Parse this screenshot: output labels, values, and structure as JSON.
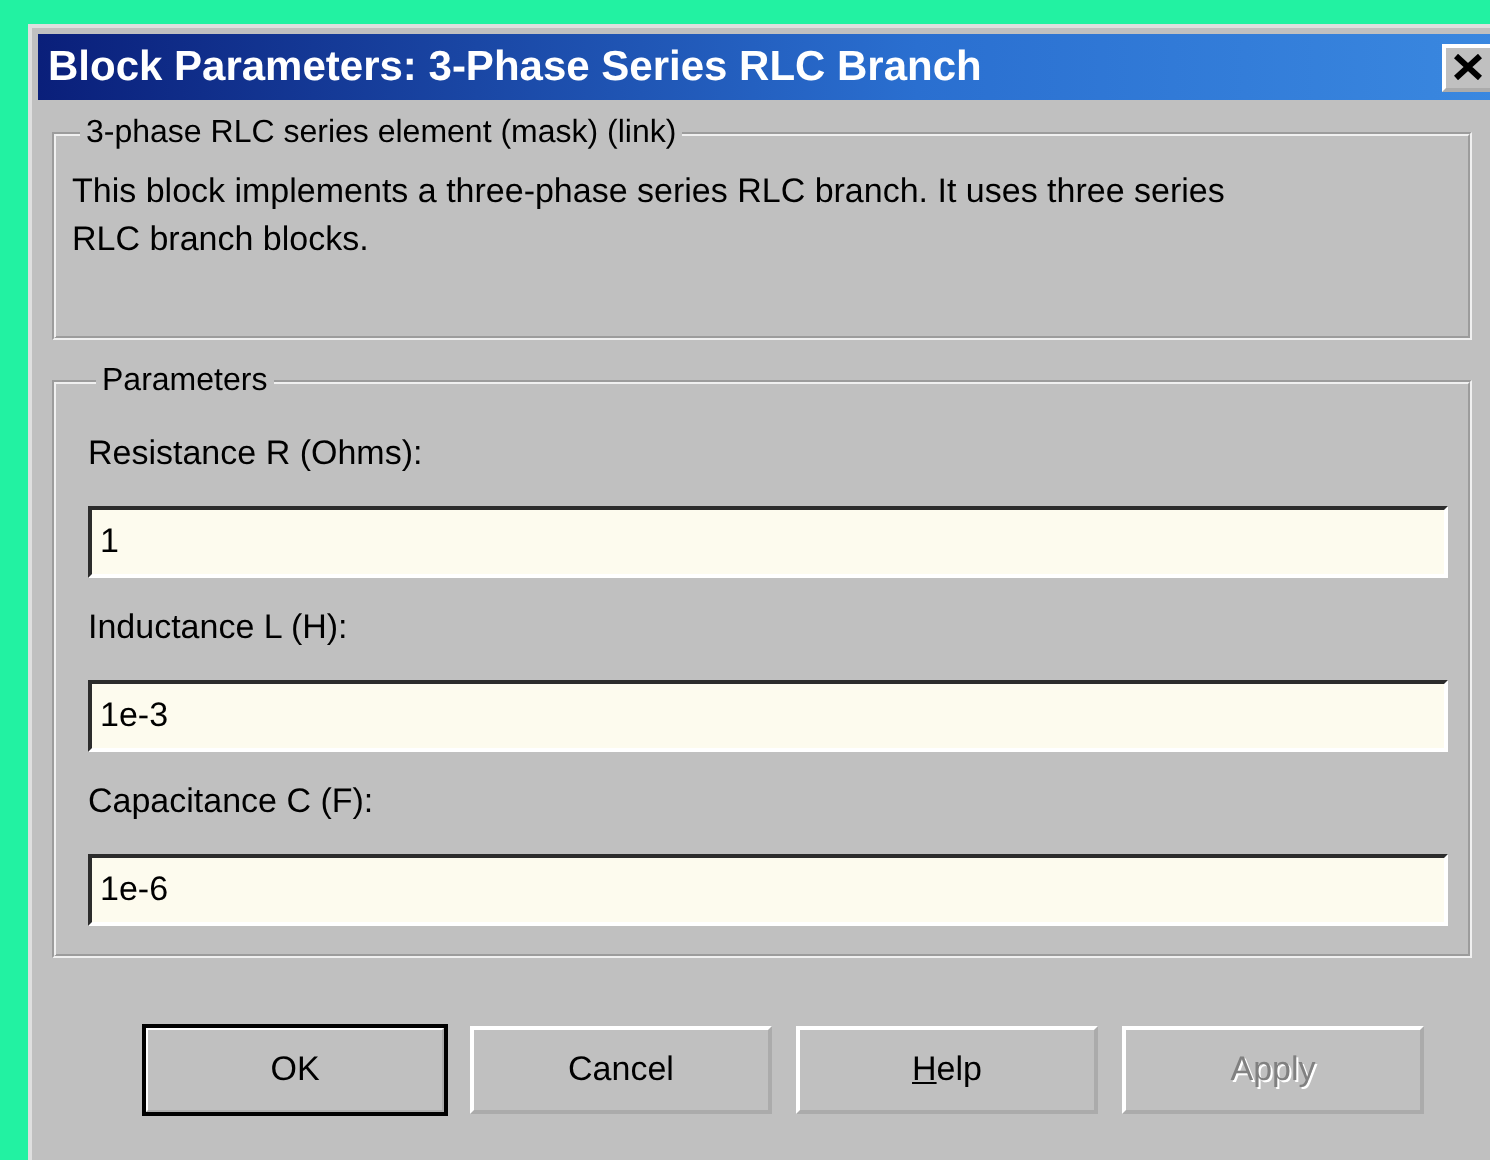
{
  "window": {
    "title": "Block Parameters: 3-Phase Series RLC Branch"
  },
  "description_group": {
    "title": "3-phase RLC series element (mask) (link)",
    "text": "This block implements a three-phase series RLC branch. It uses three series RLC branch blocks."
  },
  "parameters_group": {
    "title": "Parameters",
    "fields": [
      {
        "label": "Resistance R (Ohms):",
        "value": "1"
      },
      {
        "label": "Inductance L (H):",
        "value": "1e-3"
      },
      {
        "label": "Capacitance C (F):",
        "value": "1e-6"
      }
    ]
  },
  "buttons": [
    {
      "label": "OK",
      "default": true,
      "disabled": false
    },
    {
      "label": "Cancel",
      "default": false,
      "disabled": false
    },
    {
      "label": "Help",
      "default": false,
      "disabled": false,
      "underline_first": true
    },
    {
      "label": "Apply",
      "default": false,
      "disabled": true
    }
  ]
}
